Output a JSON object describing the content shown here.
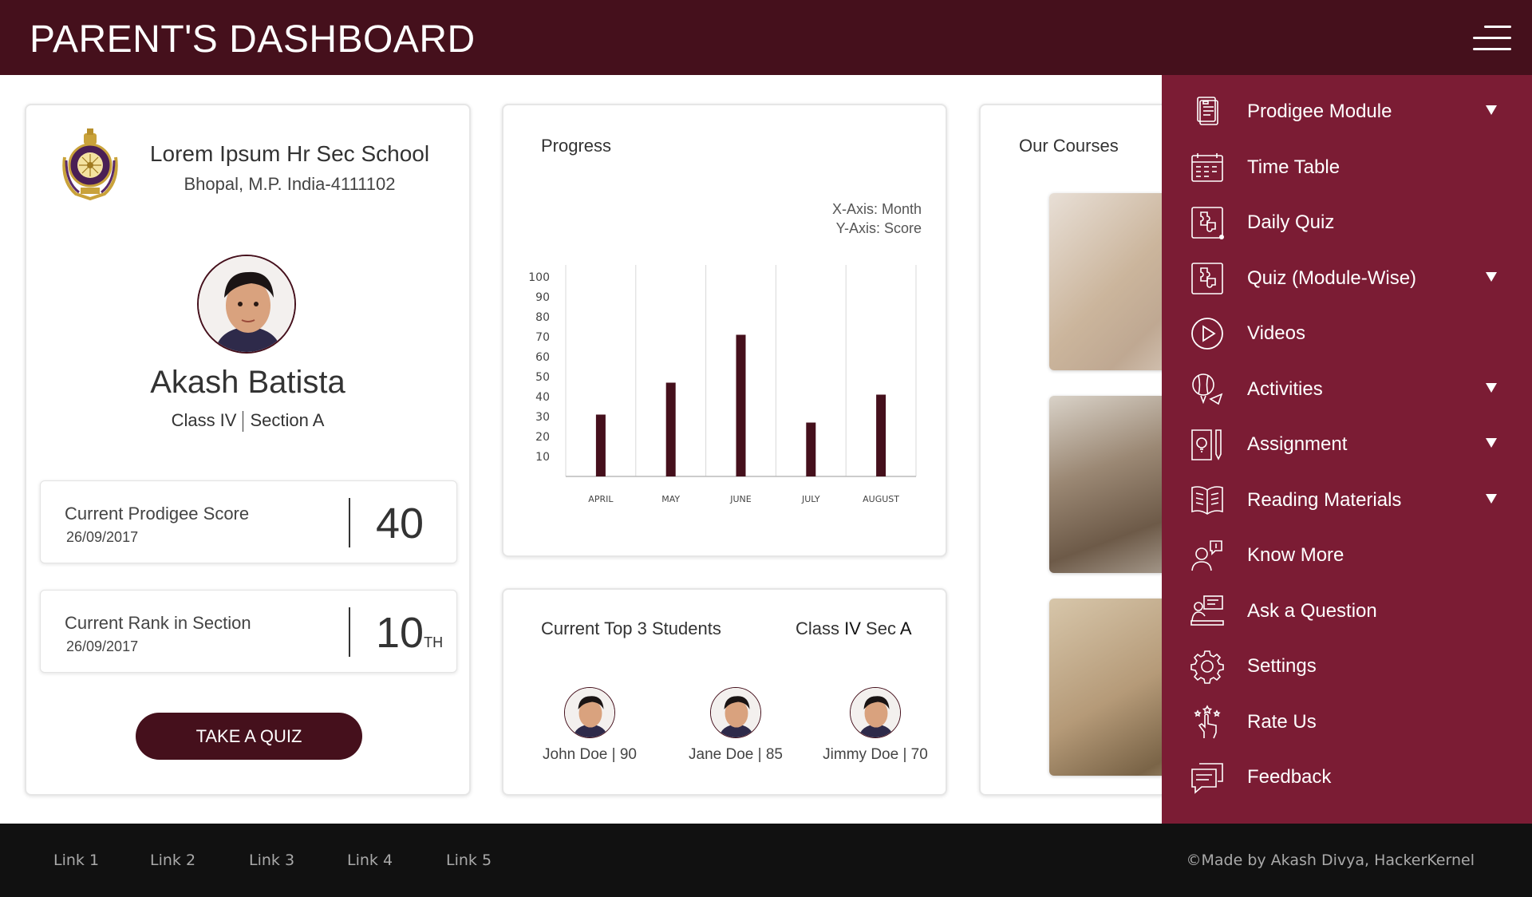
{
  "header": {
    "title": "PARENT'S DASHBOARD"
  },
  "profile": {
    "school_name": "Lorem Ipsum Hr Sec School",
    "school_address": "Bhopal, M.P. India-4111102",
    "student_name": "Akash Batista",
    "class": "Class IV",
    "section": "Section A",
    "score": {
      "label": "Current Prodigee Score",
      "date": "26/09/2017",
      "value": "40"
    },
    "rank": {
      "label": "Current Rank in Section",
      "date": "26/09/2017",
      "value": "10",
      "suffix": "TH"
    },
    "quiz_button": "TAKE A QUIZ"
  },
  "progress": {
    "title": "Progress",
    "x_note": "X-Axis: Month",
    "y_note": "Y-Axis: Score"
  },
  "chart_data": {
    "type": "bar",
    "categories": [
      "APRIL",
      "MAY",
      "JUNE",
      "JULY",
      "AUGUST"
    ],
    "values": [
      31,
      47,
      71,
      27,
      41
    ],
    "y_ticks": [
      10,
      20,
      30,
      40,
      50,
      60,
      70,
      80,
      90,
      100
    ],
    "ylim": [
      0,
      106
    ],
    "bar_color": "#45101c",
    "grid": true
  },
  "top3": {
    "title": "Current Top 3 Students",
    "class_prefix": "Class ",
    "class_roman": "IV",
    "class_mid": " Sec ",
    "class_section": "A",
    "students": [
      {
        "name": "John Doe | 90"
      },
      {
        "name": "Jane Doe | 85"
      },
      {
        "name": "Jimmy Doe | 70"
      }
    ]
  },
  "courses": {
    "title": "Our Courses"
  },
  "menu": {
    "items": [
      {
        "label": "Prodigee Module",
        "icon": "document-icon",
        "has_dropdown": true
      },
      {
        "label": "Time Table",
        "icon": "calendar-icon",
        "has_dropdown": false
      },
      {
        "label": "Daily Quiz",
        "icon": "puzzle-icon",
        "has_dropdown": false
      },
      {
        "label": "Quiz (Module-Wise)",
        "icon": "puzzle-icon",
        "has_dropdown": true
      },
      {
        "label": "Videos",
        "icon": "play-icon",
        "has_dropdown": false
      },
      {
        "label": "Activities",
        "icon": "balloon-icon",
        "has_dropdown": true
      },
      {
        "label": "Assignment",
        "icon": "idea-pencil-icon",
        "has_dropdown": true
      },
      {
        "label": "Reading Materials",
        "icon": "book-icon",
        "has_dropdown": true
      },
      {
        "label": "Know More",
        "icon": "person-info-icon",
        "has_dropdown": false
      },
      {
        "label": "Ask a Question",
        "icon": "person-board-icon",
        "has_dropdown": false
      },
      {
        "label": "Settings",
        "icon": "gear-icon",
        "has_dropdown": false
      },
      {
        "label": "Rate Us",
        "icon": "hand-stars-icon",
        "has_dropdown": false
      },
      {
        "label": "Feedback",
        "icon": "chat-icon",
        "has_dropdown": false
      }
    ]
  },
  "footer": {
    "links": [
      "Link 1",
      "Link 2",
      "Link 3",
      "Link 4",
      "Link 5"
    ],
    "copyright": "©Made by Akash Divya, HackerKernel"
  },
  "colors": {
    "primary_dark": "#45101c",
    "menu_bg": "#7b1c34",
    "footer_bg": "#111111"
  }
}
